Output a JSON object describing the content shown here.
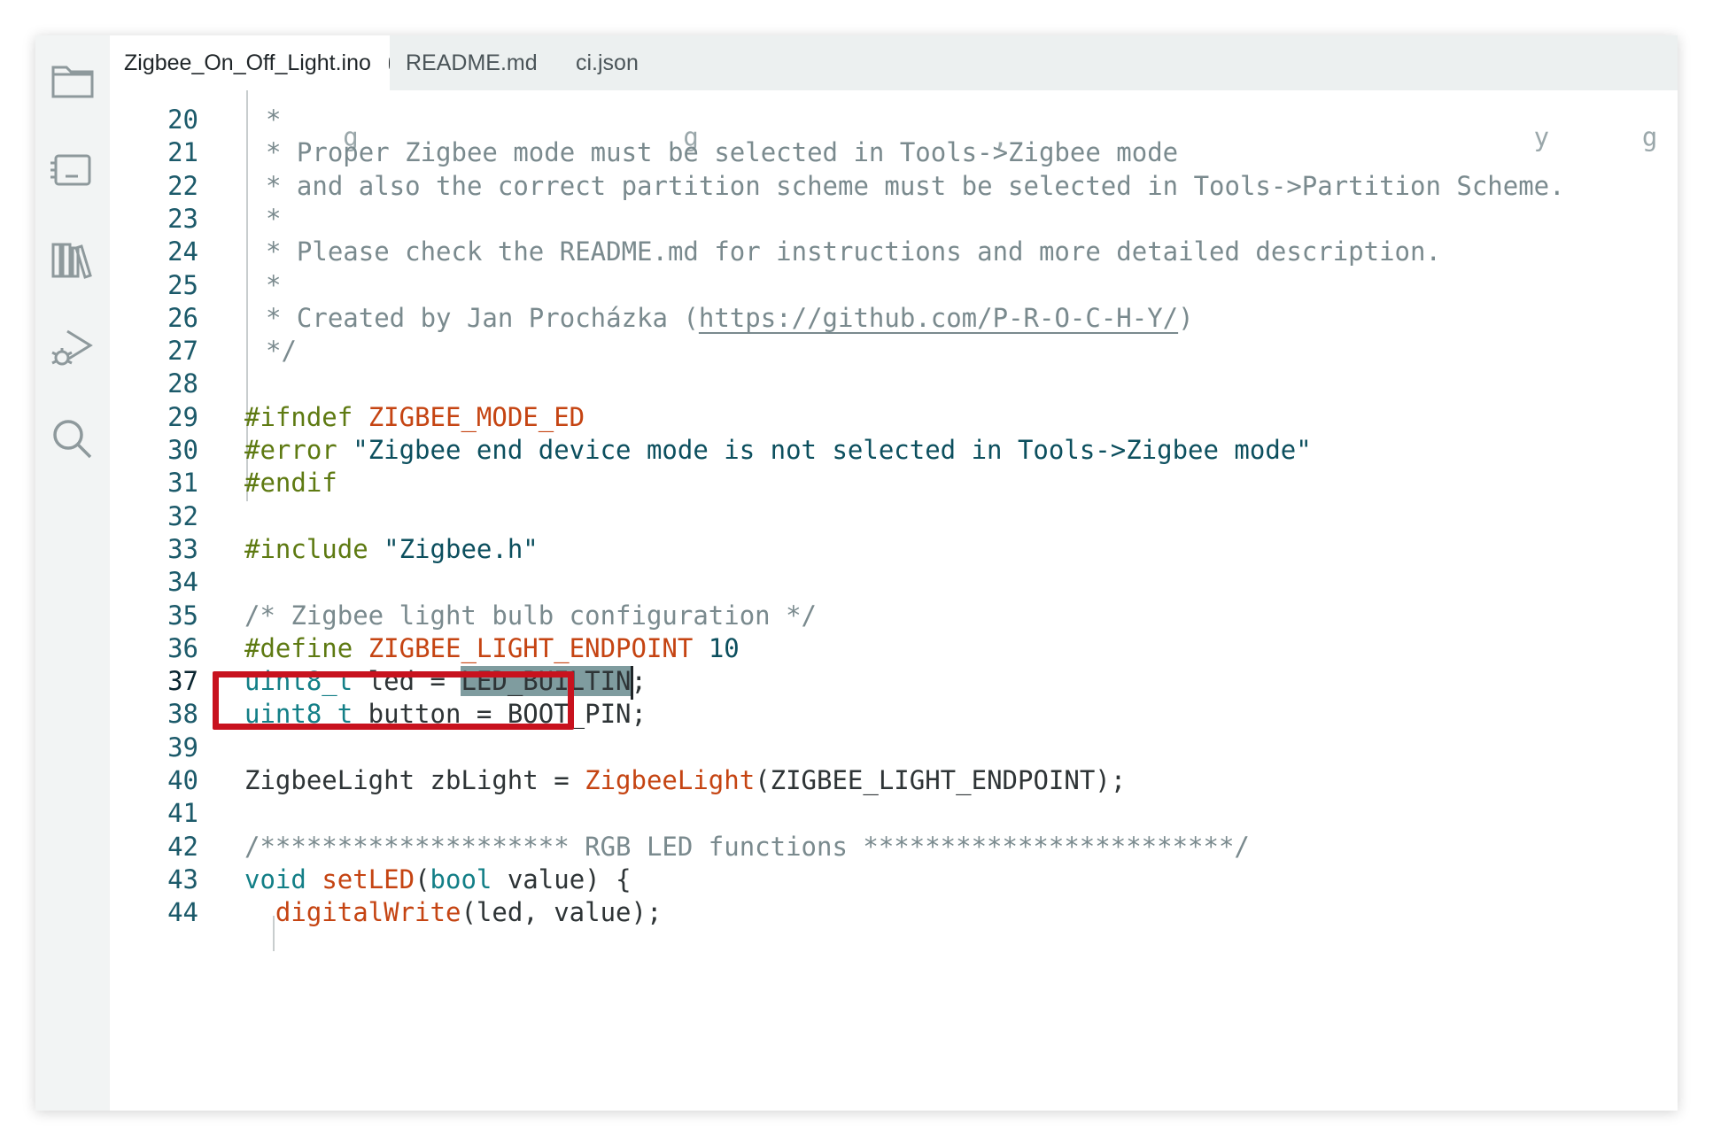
{
  "tabs": [
    {
      "label": "Zigbee_On_Off_Light.ino",
      "active": true,
      "unsaved": true
    },
    {
      "label": "README.md",
      "active": false,
      "unsaved": false
    },
    {
      "label": "ci.json",
      "active": false,
      "unsaved": false
    }
  ],
  "activity_bar": {
    "icons": [
      "folder-icon",
      "board-manager-icon",
      "library-manager-icon",
      "debug-icon",
      "search-icon"
    ]
  },
  "colors": {
    "highlight_box": "#c8121e",
    "selection": "#7f9c9f",
    "line_number": "#1c5a6a"
  },
  "editor": {
    "current_line": "37",
    "selected_text": "LED_BUILTIN",
    "lines": [
      {
        "num": "20",
        "tokens": [
          {
            "t": "*",
            "c": "comment"
          }
        ]
      },
      {
        "num": "21",
        "tokens": [
          {
            "t": "* Proper Zigbee mode must be selected in Tools->Zigbee mode",
            "c": "comment"
          }
        ]
      },
      {
        "num": "22",
        "tokens": [
          {
            "t": "* and also the correct partition scheme must be selected in Tools->Partition Scheme.",
            "c": "comment"
          }
        ]
      },
      {
        "num": "23",
        "tokens": [
          {
            "t": "*",
            "c": "comment"
          }
        ]
      },
      {
        "num": "24",
        "tokens": [
          {
            "t": "* Please check the README.md for instructions and more detailed description.",
            "c": "comment"
          }
        ]
      },
      {
        "num": "25",
        "tokens": [
          {
            "t": "*",
            "c": "comment"
          }
        ]
      },
      {
        "num": "26",
        "tokens": [
          {
            "t": "* Created by Jan Procházka (",
            "c": "comment"
          },
          {
            "t": "https://github.com/P-R-O-C-H-Y/",
            "c": "link"
          },
          {
            "t": ")",
            "c": "comment"
          }
        ]
      },
      {
        "num": "27",
        "tokens": [
          {
            "t": "*/",
            "c": "comment"
          }
        ]
      },
      {
        "num": "28",
        "tokens": []
      },
      {
        "num": "29",
        "tokens": [
          {
            "t": "#ifndef ",
            "c": "preproc"
          },
          {
            "t": "ZIGBEE_MODE_ED",
            "c": "macro"
          }
        ]
      },
      {
        "num": "30",
        "tokens": [
          {
            "t": "#error ",
            "c": "preproc"
          },
          {
            "t": "\"Zigbee end device mode is not selected in Tools->Zigbee mode\"",
            "c": "string"
          }
        ]
      },
      {
        "num": "31",
        "tokens": [
          {
            "t": "#endif",
            "c": "preproc"
          }
        ]
      },
      {
        "num": "32",
        "tokens": []
      },
      {
        "num": "33",
        "tokens": [
          {
            "t": "#include ",
            "c": "preproc"
          },
          {
            "t": "\"Zigbee.h\"",
            "c": "string"
          }
        ]
      },
      {
        "num": "34",
        "tokens": []
      },
      {
        "num": "35",
        "tokens": [
          {
            "t": "/* Zigbee light bulb configuration */",
            "c": "comment"
          }
        ]
      },
      {
        "num": "36",
        "tokens": [
          {
            "t": "#define ",
            "c": "preproc"
          },
          {
            "t": "ZIGBEE_LIGHT_ENDPOINT",
            "c": "macro"
          },
          {
            "t": " ",
            "c": "plain"
          },
          {
            "t": "10",
            "c": "num"
          }
        ]
      },
      {
        "num": "37",
        "tokens": [
          {
            "t": "uint8_t",
            "c": "type"
          },
          {
            "t": " led = ",
            "c": "plain"
          },
          {
            "t": "LED_BUILTIN",
            "c": "selected"
          },
          {
            "t": ";",
            "c": "plain"
          }
        ]
      },
      {
        "num": "38",
        "tokens": [
          {
            "t": "uint8_t",
            "c": "type"
          },
          {
            "t": " button = BOOT_PIN;",
            "c": "plain"
          }
        ]
      },
      {
        "num": "39",
        "tokens": []
      },
      {
        "num": "40",
        "tokens": [
          {
            "t": "ZigbeeLight zbLight = ",
            "c": "plain"
          },
          {
            "t": "ZigbeeLight",
            "c": "func"
          },
          {
            "t": "(ZIGBEE_LIGHT_ENDPOINT);",
            "c": "plain"
          }
        ]
      },
      {
        "num": "41",
        "tokens": []
      },
      {
        "num": "42",
        "tokens": [
          {
            "t": "/******************** RGB LED functions ************************/",
            "c": "comment"
          }
        ]
      },
      {
        "num": "43",
        "tokens": [
          {
            "t": "void",
            "c": "type"
          },
          {
            "t": " ",
            "c": "plain"
          },
          {
            "t": "setLED",
            "c": "func"
          },
          {
            "t": "(",
            "c": "plain"
          },
          {
            "t": "bool",
            "c": "type"
          },
          {
            "t": " value) {",
            "c": "plain"
          }
        ]
      },
      {
        "num": "44",
        "tokens": [
          {
            "t": "  ",
            "c": "plain"
          },
          {
            "t": "digitalWrite",
            "c": "func"
          },
          {
            "t": "(led, value);",
            "c": "plain"
          }
        ]
      }
    ]
  }
}
